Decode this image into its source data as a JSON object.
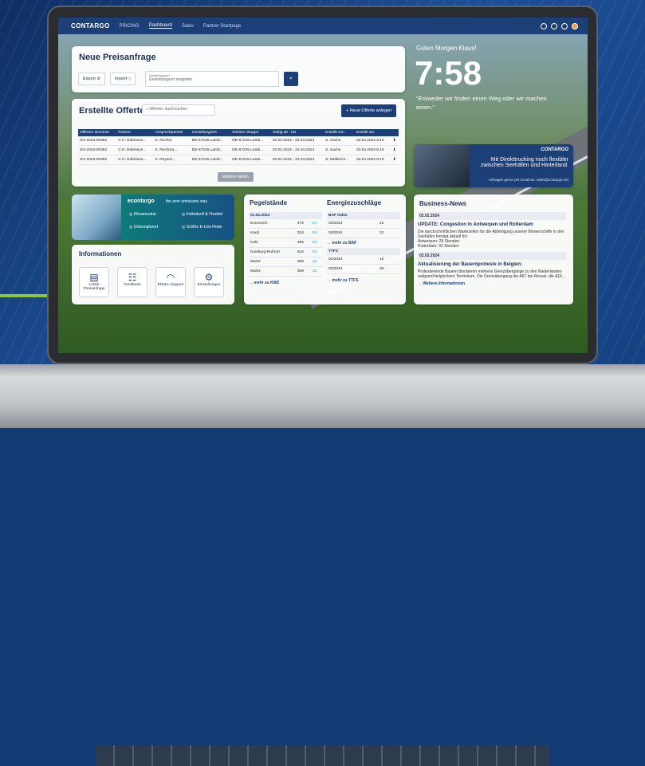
{
  "nav": {
    "logo": "CONTARGO",
    "items": [
      "PRICING",
      "Dashboard",
      "Sales",
      "Partner Startpage"
    ]
  },
  "preisanfrage": {
    "title": "Neue Preisanfrage",
    "export": "Export",
    "import": "Import",
    "field_label": "Gestellungsort",
    "field_placeholder": "Gestellungsort eingeben"
  },
  "offerten": {
    "title": "Erstellte Offerten",
    "search_placeholder": "Offerten durchsuchen",
    "new_button": "Neue Offerte anlegen",
    "load_more": "weitere laden",
    "columns": [
      "Offerten Nummer",
      "Partner",
      "Ansprechpartner",
      "Gestellungsort",
      "Weitere Stopps",
      "Gültig ab - bis",
      "Erstellt von",
      "Erstellt am"
    ],
    "rows": [
      [
        "SO-2024-00392",
        "C.H. Robinson...",
        "S. Rochel",
        "DE-67245 Lamb...",
        "DE-67245 Lamb...",
        "02.04.2024 - 22.04.2024",
        "S. Sachs",
        "02.04.2024 8:16"
      ],
      [
        "SO-2024-00392",
        "C.H. Robinson...",
        "S. Rochma...",
        "DE-67245 Lamb...",
        "DE-67245 Lamb...",
        "02.04.2024 - 22.04.2024",
        "S. Sachs",
        "02.04.2024 8:16"
      ],
      [
        "SO-2024-00392",
        "C.H. Robinson...",
        "S. Roysch...",
        "DE-67245 Lamb...",
        "DE-67245 Lamb...",
        "02.04.2024 - 22.04.2024",
        "S. Müllerich...",
        "02.04.2024 8:16"
      ]
    ]
  },
  "greeting": {
    "hello": "Guten Morgen Klaus!",
    "time": "7:58",
    "quote": "“Entweder wir finden einen Weg oder wir machen einen.”"
  },
  "promo": {
    "logo": "CONTARGO",
    "line1": "Mit Direkttrucking noch flexibler",
    "line2": "zwischen Seehäfen und Hinterland.",
    "contact": "Anfragen gerne per Email an: sales@contargo.net"
  },
  "eco": {
    "brand": "econtargo",
    "tagline": "the zero emissions way",
    "f1": "Klimaneutral",
    "f2": "Individuell & Flexibel",
    "f3": "Unkompliziert",
    "f4": "Größte E-Lkw Flotte"
  },
  "info": {
    "title": "Informationen",
    "tiles": [
      "Letzte Preisanfrage",
      "Feedback",
      "EDI&A-Support",
      "Einstellungen"
    ]
  },
  "pegel": {
    "title": "Pegelstände",
    "date": "01.02.2024",
    "rows": [
      [
        "Emmerich",
        "476",
        "-24"
      ],
      [
        "Kaub",
        "334",
        "-26"
      ],
      [
        "Köln",
        "485",
        "-33"
      ],
      [
        "Duisburg-Ruhrort",
        "616",
        "-29"
      ],
      [
        "Mainz",
        "388",
        "-15"
      ],
      [
        "Mainz",
        "388",
        "-15"
      ]
    ],
    "link": "mehr zu KWZ"
  },
  "energie": {
    "title": "Energiezuschläge",
    "baf": "BAF Index",
    "baf_rows": [
      [
        "02/2024",
        "22"
      ],
      [
        "03/2024",
        "22"
      ]
    ],
    "baf_link": "mehr zu BAF",
    "ttfs": "TTFS",
    "ttfs_rows": [
      [
        "01/2024",
        "10"
      ],
      [
        "02/2024",
        "09"
      ]
    ],
    "ttfs_link": "mehr zu TTFS"
  },
  "news": {
    "title": "Business-News",
    "d1": "02.02.2024",
    "h1": "UPDATE: Congestion in Antwerpen und Rotterdam",
    "t1": "Die durchschnittlichen Wartezeiten für die Abfertigung unserer Binnenschiffe in den Seehäfen beträgt aktuell für:",
    "t1b": "Antwerpen: 28 Stunden",
    "t1c": "Rotterdam: 33 Stunden",
    "d2": "02.02.2024",
    "h2": "Aktualisierung der Bauernproteste in Belgien:",
    "t2": "Protestierende Bauern blockieren mehrere Grenzübergänge zu den Niederlanden aufgrund belgischem Territorium. Die Grenzübergang der A67 bei Reesel, die A16...",
    "more": "Weitere Informationen"
  }
}
